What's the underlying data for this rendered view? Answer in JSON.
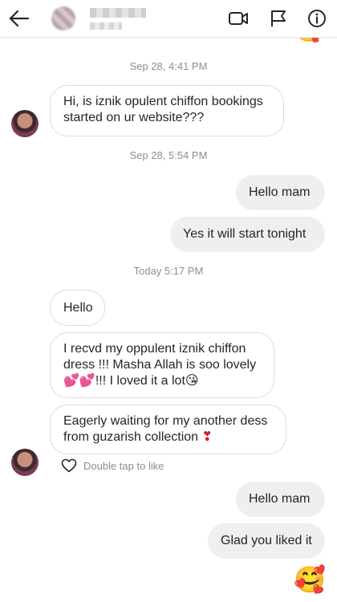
{
  "header": {
    "back_icon": "arrow-left-icon",
    "actions": [
      {
        "icon": "video-camera-icon"
      },
      {
        "icon": "flag-icon"
      },
      {
        "icon": "info-icon"
      }
    ]
  },
  "messages": {
    "ts1": "Sep 28, 4:41 PM",
    "in1": "Hi, is iznik opulent chiffon bookings started on ur website???",
    "ts2": "Sep 28, 5:54 PM",
    "out1": "Hello mam",
    "out2": "Yes it will start tonight",
    "ts3": "Today 5:17 PM",
    "in2": "Hello",
    "in3_line1": "I recvd my oppulent iznik chiffon",
    "in3_line2": "dress !!! Masha Allah is soo lovely",
    "in3_emoji_hearts": "💕💕",
    "in3_line3": "!!! I loved it a lot",
    "in3_emoji_kiss": "😘",
    "in4_line1": "Eagerly waiting for my another dess",
    "in4_line2": "from guzarish collection ",
    "in4_emoji_heart": "❣",
    "like_hint": "Double tap to like",
    "out3": "Hello mam",
    "out4": "Glad you liked it",
    "out5_emoji": "🥰"
  },
  "colors": {
    "incoming_bg": "#ffffff",
    "incoming_border": "#dbdbdb",
    "outgoing_bg": "#efefef",
    "timestamp": "#8e8e8e",
    "text": "#262626"
  }
}
